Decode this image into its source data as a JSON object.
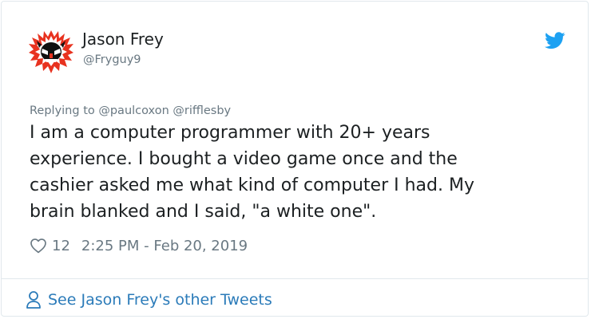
{
  "author": {
    "name": "Jason Frey",
    "handle": "@Fryguy9"
  },
  "reply": {
    "text": "Replying to @paulcoxon @rifflesby"
  },
  "tweet": {
    "lines": [
      "I am a computer programmer with 20+ years",
      "experience. I bought a video game once and the",
      "cashier asked me what kind of computer I had. My",
      "brain blanked and I said, \"a white one\"."
    ]
  },
  "meta": {
    "likes": "12",
    "timestamp": "2:25 PM - Feb 20, 2019"
  },
  "footer": {
    "see_more": "See Jason Frey's other Tweets"
  },
  "colors": {
    "accent": "#1da1f2",
    "link": "#2b7bb9",
    "muted": "#697882",
    "border": "#e1e8ed"
  },
  "icons": {
    "brand": "twitter-bird-icon",
    "like": "heart-icon",
    "profile": "person-icon"
  }
}
